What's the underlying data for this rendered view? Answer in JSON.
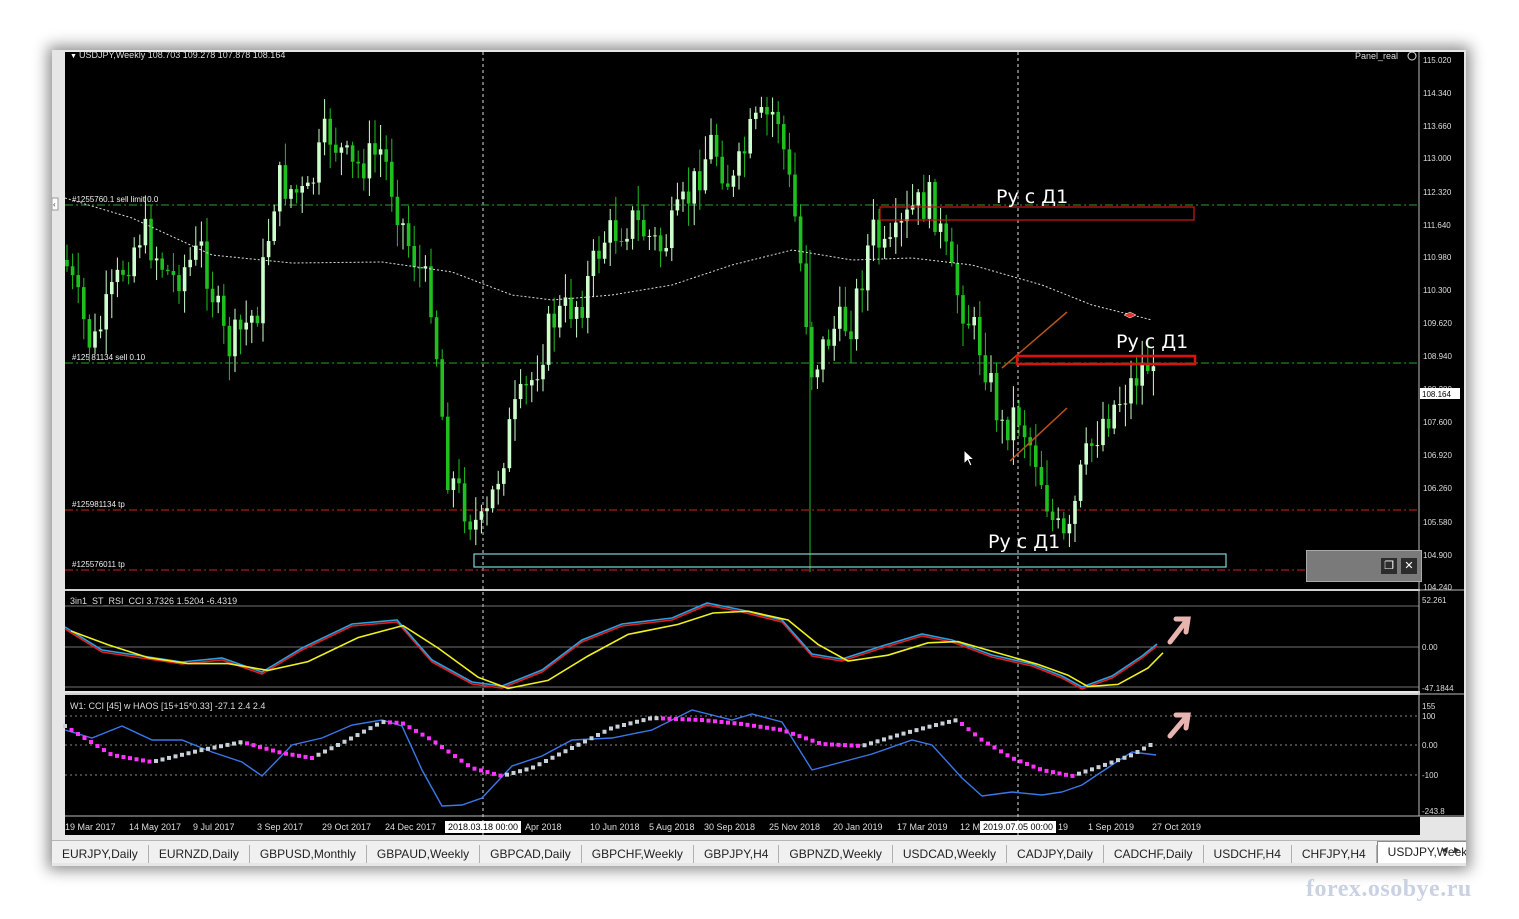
{
  "chart_header": {
    "title": "USDJPY,Weekly  108.703 109.278 107.878 108.164",
    "panel_label": "Panel_real"
  },
  "price_axis": {
    "labels": [
      "115.020",
      "114.340",
      "113.660",
      "113.000",
      "112.320",
      "111.640",
      "110.980",
      "110.300",
      "109.620",
      "108.940",
      "108.280",
      "107.600",
      "106.920",
      "106.260",
      "105.580",
      "104.900",
      "104.240"
    ],
    "current_price": "108.164"
  },
  "order_lines": [
    {
      "label": "#1255760.1 sell limit 0.0",
      "color": "#2aa02a"
    },
    {
      "label": "#125 81134 sell 0.10",
      "color": "#2aa02a"
    },
    {
      "label": "#125981134 tp",
      "color": "#d42020"
    },
    {
      "label": "#125576011 tp",
      "color": "#d42020"
    }
  ],
  "annotations": [
    "Ру с Д1",
    "Ру с Д1",
    "Ру с Д1"
  ],
  "indicator1": {
    "label": "3in1_ST_RSI_CCI 3.7326 1.5204 -6.4319",
    "axis_labels": [
      "52.261",
      "0.00",
      "-47.1844"
    ]
  },
  "indicator2": {
    "label": "W1: CCI [45] w HAOS [15+15*0.33] -27.1 2.4 2.4",
    "axis_labels": [
      "155",
      "100",
      "0.00",
      "-100",
      "-243.8"
    ]
  },
  "time_axis": {
    "labels": [
      "19 Mar 2017",
      "14 May 2017",
      "9 Jul 2017",
      "3 Sep 2017",
      "29 Oct 2017",
      "24 Dec 2017",
      "Apr 2018",
      "10 Jun 2018",
      "5 Aug 2018",
      "30 Sep 2018",
      "25 Nov 2018",
      "20 Jan 2019",
      "17 Mar 2019",
      "12 M",
      "1 Sep 2019",
      "27 Oct 2019"
    ],
    "crosshair_labels": [
      "2018.03.18 00:00",
      "2019.07.05 00:00"
    ],
    "partial_after": "19"
  },
  "tabs": [
    "EURJPY,Daily",
    "EURNZD,Daily",
    "GBPUSD,Monthly",
    "GBPAUD,Weekly",
    "GBPCAD,Daily",
    "GBPCHF,Weekly",
    "GBPJPY,H4",
    "GBPNZD,Weekly",
    "USDCAD,Weekly",
    "CADJPY,Daily",
    "CADCHF,Daily",
    "USDCHF,H4",
    "CHFJPY,H4",
    "USDJPY,Weekly"
  ],
  "active_tab": "USDJPY,Weekly",
  "watermark": "forex.osobye.ru",
  "colors": {
    "bull": "#ccffcc",
    "bear": "#1fbf1f",
    "chart_bg": "#000000",
    "annotation_box": "#d01818",
    "support_box": "#7fd6d6"
  }
}
